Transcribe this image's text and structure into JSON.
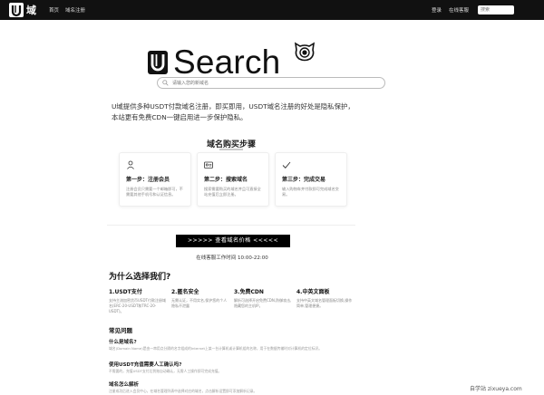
{
  "nav": {
    "logo_text": "域",
    "links": [
      "首页",
      "域名注册"
    ],
    "right_links": [
      "登录",
      "在线客服"
    ],
    "search_placeholder": "搜索"
  },
  "hero": {
    "title": "Search",
    "search_placeholder": "请输入您的新域名"
  },
  "intro": "U域提供多种USDT付款域名注册，即买即用，USDT域名注册的好处是隐私保护，本站更有免费CDN一键启用进一步保护隐私。",
  "steps": {
    "title": "域名购买步骤",
    "cards": [
      {
        "icon": "user-icon",
        "title": "第一步：注册会员",
        "desc": "注册会员只需要一个邮箱即可，不需要其他手机号和认证信息。"
      },
      {
        "icon": "id-card-icon",
        "title": "第二步：搜索域名",
        "desc": "搜索需要购买的域名并且可直接全站充值后立即注册。"
      },
      {
        "icon": "checkmark-icon",
        "title": "第三步：完成交易",
        "desc": "输入购物车并付款即可完成域名交易。"
      }
    ]
  },
  "cta": {
    "label": ">>>>>  查看域名价格  <<<<<",
    "hours": "在线客服工作时间 10:00-22:00"
  },
  "why": {
    "title": "为什么选择我们?",
    "features": [
      {
        "title": "1.USDT支付",
        "desc": "支持主流加密货币USDT付款注册域名(ERC-20-USDT和TRC-20-USDT)。"
      },
      {
        "title": "2.匿名安全",
        "desc": "无需认证，不用实名,保护您的个人隐私不泄露"
      },
      {
        "title": "3.免费CDN",
        "desc": "解析可选择开启免费CDN,防御攻击,隐藏您的主机IP。"
      },
      {
        "title": "4.中英文面板",
        "desc": "支持中英文域名管理面板切换,操作简单,管理便捷。"
      }
    ]
  },
  "faq": {
    "title": "常见问题",
    "items": [
      {
        "q": "什么是域名?",
        "a": "域名(Domain Name)是由一串用点分隔的名字组成的Internet上某一台计算机或计算机组的名称，用于在数据传输时对计算机的定位标识。"
      },
      {
        "q": "使用USDT充值需要人工确认吗?",
        "a": "不需要的，充值USDT支付后到账自动确认，无需人工操作即可完成充值。"
      },
      {
        "q": "域名怎么解析",
        "a": "注册成功后进入会员中心，在域名管理列表中选择对应的域名，点击解析设置即可添加解析记录。"
      }
    ]
  },
  "watermark": "自学站 zixueya.com"
}
